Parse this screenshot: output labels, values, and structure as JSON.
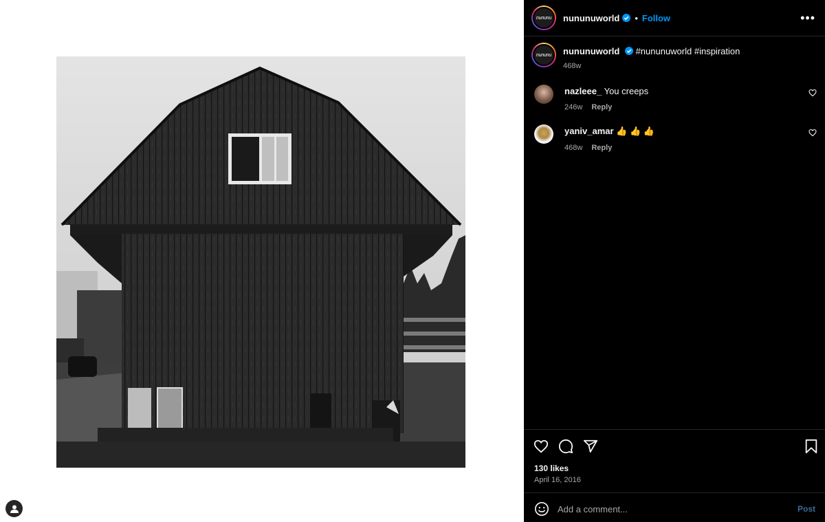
{
  "post": {
    "author": "nununuworld",
    "avatar_text": "nununu",
    "follow_label": "Follow",
    "separator": "•",
    "more_label": "•••",
    "caption_text": "#nununuworld #inspiration",
    "caption_time": "468w",
    "likes": "130 likes",
    "date": "April 16, 2016",
    "image_subject": "barn-photo"
  },
  "comments": [
    {
      "user": "nazleee_",
      "text": "You creeps",
      "time": "246w",
      "reply_label": "Reply"
    },
    {
      "user": "yaniv_amar",
      "text": "👍 👍 👍",
      "time": "468w",
      "reply_label": "Reply"
    }
  ],
  "composer": {
    "placeholder": "Add a comment...",
    "post_label": "Post"
  },
  "colors": {
    "accent": "#0095f6",
    "panel_bg": "#000000",
    "muted_text": "#a8a8a8"
  }
}
